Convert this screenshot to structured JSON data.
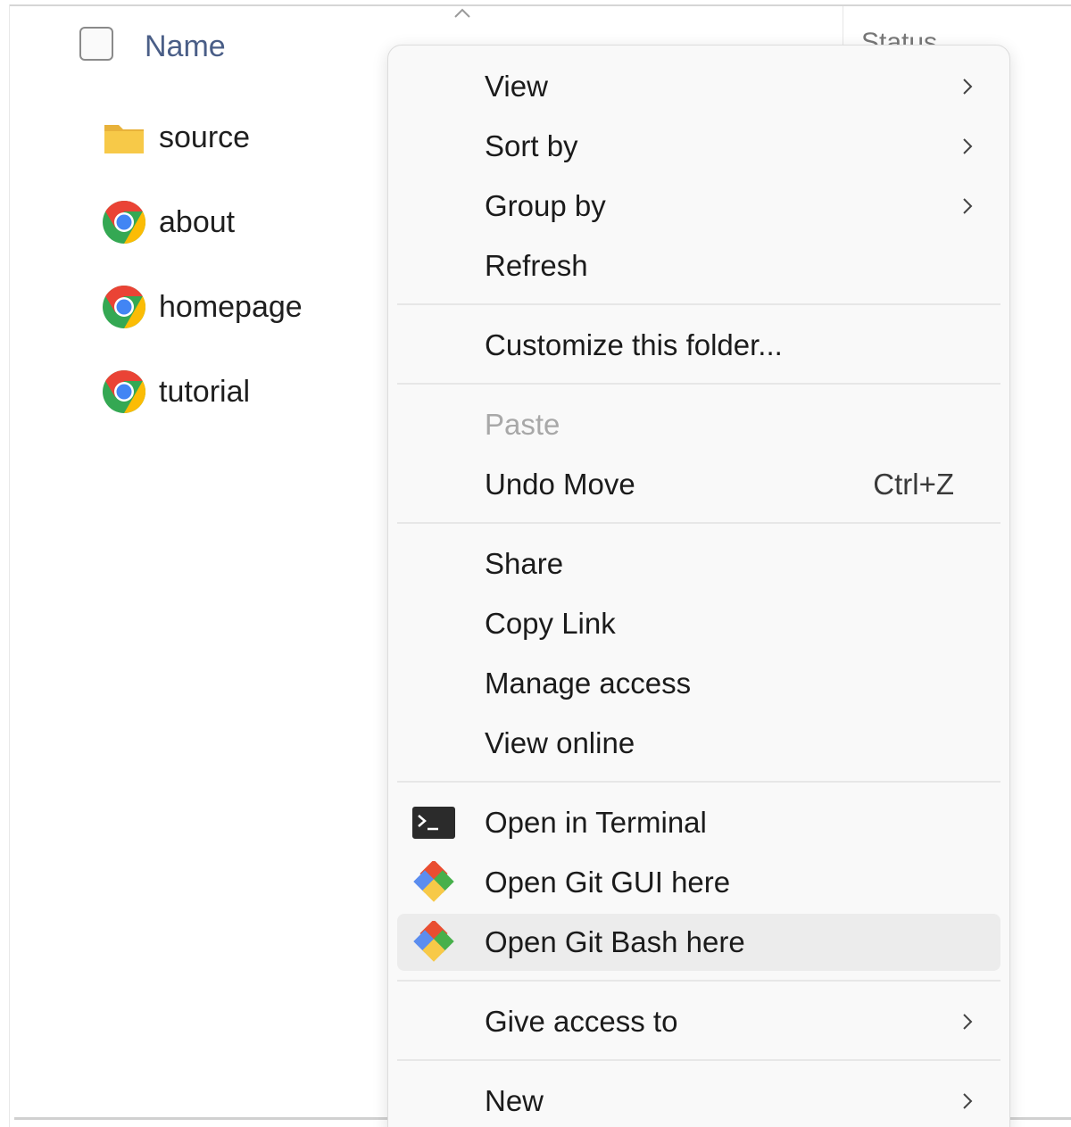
{
  "list_header": {
    "name_label": "Name",
    "status_label": "Status"
  },
  "files": [
    {
      "name": "source",
      "icon": "folder-icon"
    },
    {
      "name": "about",
      "icon": "chrome-icon"
    },
    {
      "name": "homepage",
      "icon": "chrome-icon"
    },
    {
      "name": "tutorial",
      "icon": "chrome-icon"
    }
  ],
  "context_menu": {
    "view": "View",
    "sort_by": "Sort by",
    "group_by": "Group by",
    "refresh": "Refresh",
    "customize_folder": "Customize this folder...",
    "paste": "Paste",
    "undo_move": "Undo Move",
    "undo_move_shortcut": "Ctrl+Z",
    "share": "Share",
    "copy_link": "Copy Link",
    "manage_access": "Manage access",
    "view_online": "View online",
    "open_in_terminal": "Open in Terminal",
    "open_git_gui": "Open Git GUI here",
    "open_git_bash": "Open Git Bash here",
    "give_access_to": "Give access to",
    "new": "New"
  },
  "colors": {
    "accent_text": "#4a5e87",
    "menu_background": "#f9f9f9",
    "hover_background": "#ececec",
    "disabled_text": "#a8a8a8",
    "folder_yellow": "#f7c948",
    "git_red": "#e94e31"
  }
}
